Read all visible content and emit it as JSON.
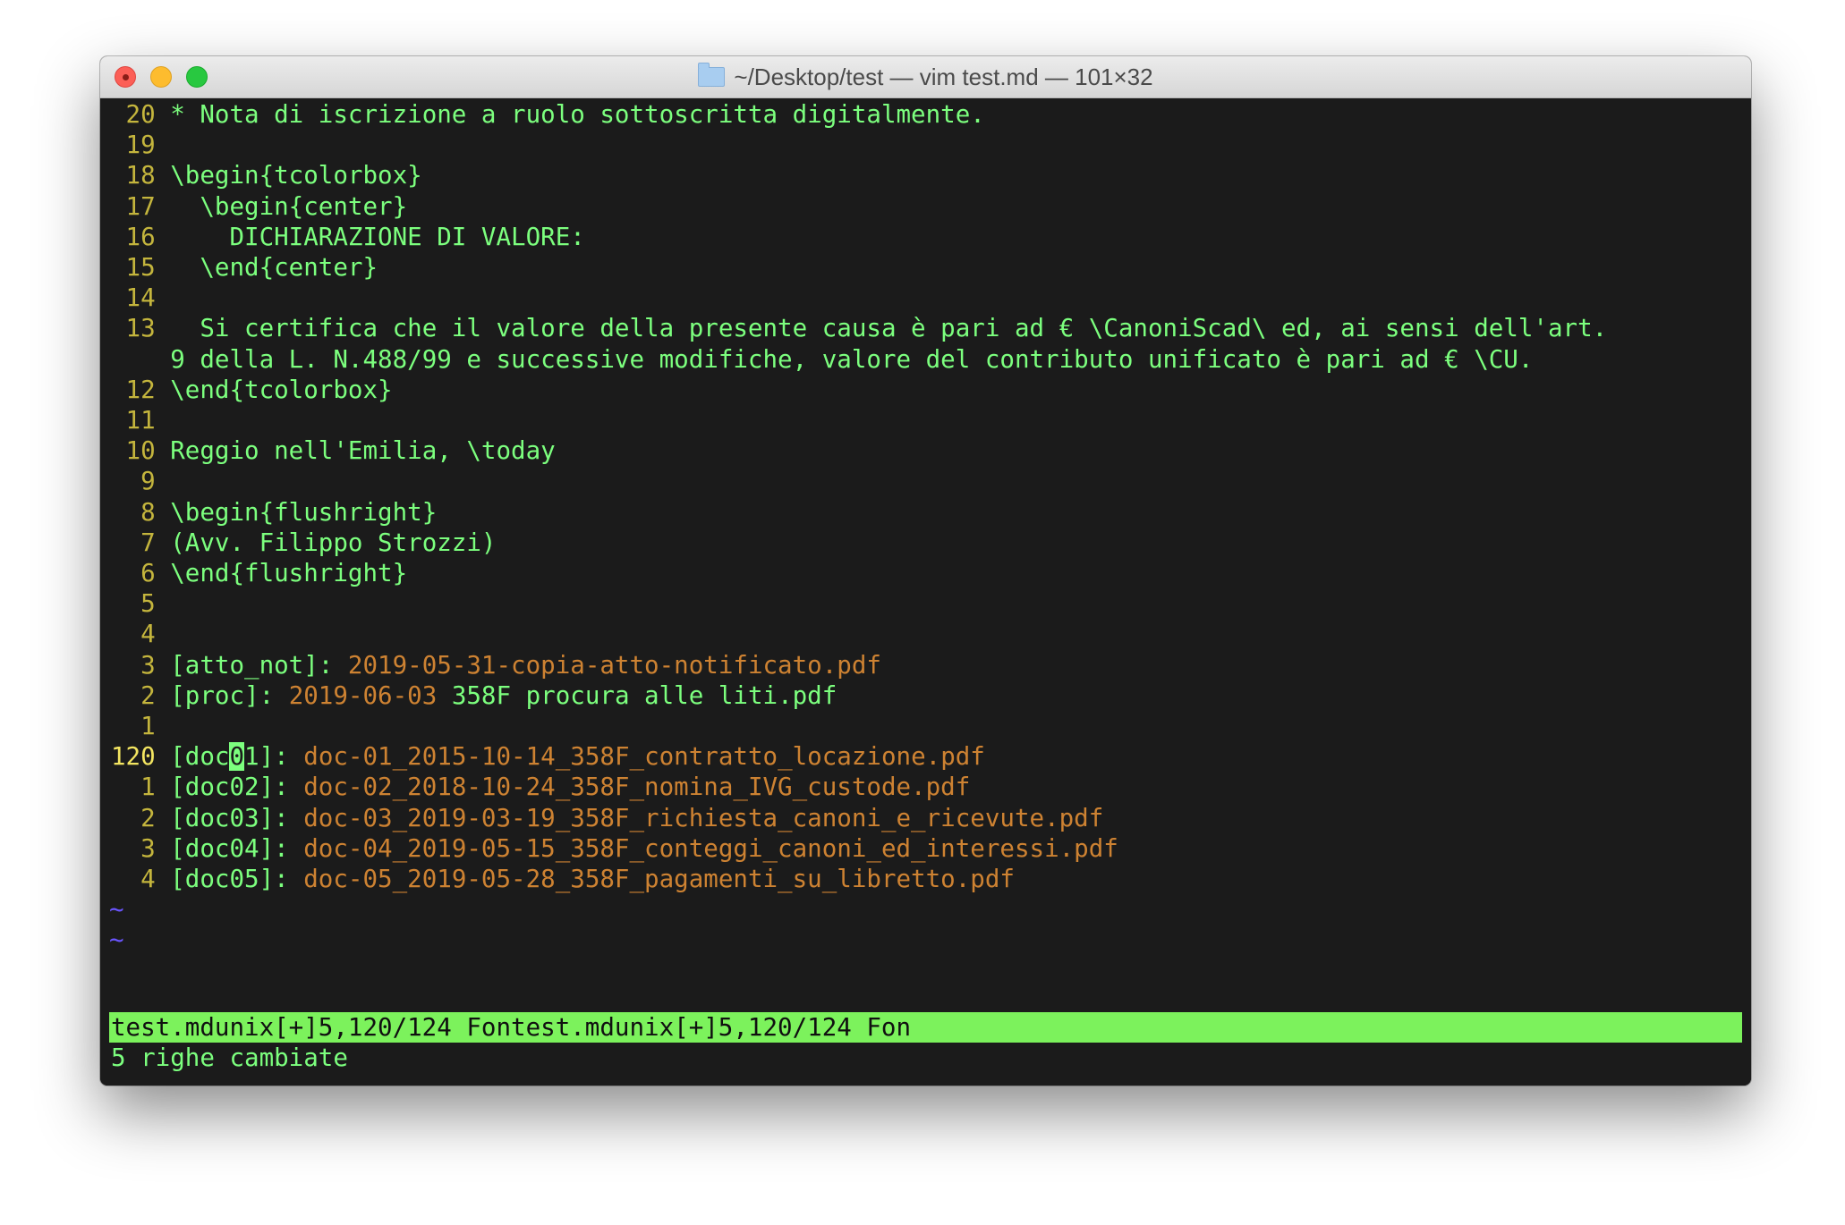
{
  "window": {
    "title": "~/Desktop/test — vim test.md — 101×32"
  },
  "colors": {
    "text": "#7cff7e",
    "line_number": "#c4b53d",
    "link_path": "#cd8232",
    "status_bar": "#7cf25c",
    "tilde": "#6a55ff",
    "background": "#1b1b1b"
  },
  "editor": {
    "lines": [
      {
        "num": "20",
        "text": "* Nota di iscrizione a ruolo sottoscritta digitalmente."
      },
      {
        "num": "19",
        "text": ""
      },
      {
        "num": "18",
        "text": "\\begin{tcolorbox}"
      },
      {
        "num": "17",
        "text": "  \\begin{center}"
      },
      {
        "num": "16",
        "text": "    DICHIARAZIONE DI VALORE:"
      },
      {
        "num": "15",
        "text": "  \\end{center}"
      },
      {
        "num": "14",
        "text": ""
      },
      {
        "num": "13",
        "text": "  Si certifica che il valore della presente causa è pari ad € \\CanoniScad\\ ed, ai sensi dell'art."
      },
      {
        "num": "",
        "text": "9 della L. N.488/99 e successive modifiche, valore del contributo unificato è pari ad € \\CU."
      },
      {
        "num": "12",
        "text": "\\end{tcolorbox}"
      },
      {
        "num": "11",
        "text": ""
      },
      {
        "num": "10",
        "text": "Reggio nell'Emilia, \\today"
      },
      {
        "num": "9",
        "text": ""
      },
      {
        "num": "8",
        "text": "\\begin{flushright}"
      },
      {
        "num": "7",
        "text": "(Avv. Filippo Strozzi)"
      },
      {
        "num": "6",
        "text": "\\end{flushright}"
      },
      {
        "num": "5",
        "text": ""
      },
      {
        "num": "4",
        "text": ""
      }
    ],
    "link_lines": [
      {
        "num": "3",
        "key": "[atto_not]: ",
        "value": "2019-05-31-copia-atto-notificato.pdf",
        "value_rest": ""
      },
      {
        "num": "2",
        "key": "[proc]: ",
        "value": "2019-06-03",
        "value_rest": " 358F procura alle liti.pdf"
      },
      {
        "num": "1",
        "key": "",
        "value": "",
        "value_rest": ""
      }
    ],
    "cursor_line": {
      "num": "120",
      "before_cursor": "[doc",
      "cursor_char": "0",
      "after_cursor": "1]: ",
      "value": "doc-01_2015-10-14_358F_contratto_locazione.pdf"
    },
    "doc_lines": [
      {
        "num": "1",
        "key": "[doc02]: ",
        "value": "doc-02_2018-10-24_358F_nomina_IVG_custode.pdf"
      },
      {
        "num": "2",
        "key": "[doc03]: ",
        "value": "doc-03_2019-03-19_358F_richiesta_canoni_e_ricevute.pdf"
      },
      {
        "num": "3",
        "key": "[doc04]: ",
        "value": "doc-04_2019-05-15_358F_conteggi_canoni_ed_interessi.pdf"
      },
      {
        "num": "4",
        "key": "[doc05]: ",
        "value": "doc-05_2019-05-28_358F_pagamenti_su_libretto.pdf"
      }
    ],
    "tildes": [
      "~",
      "~"
    ],
    "status_line": "test.mdunix[+]5,120/124 Fontest.mdunix[+]5,120/124 Fon",
    "command_line": "5 righe cambiate"
  }
}
